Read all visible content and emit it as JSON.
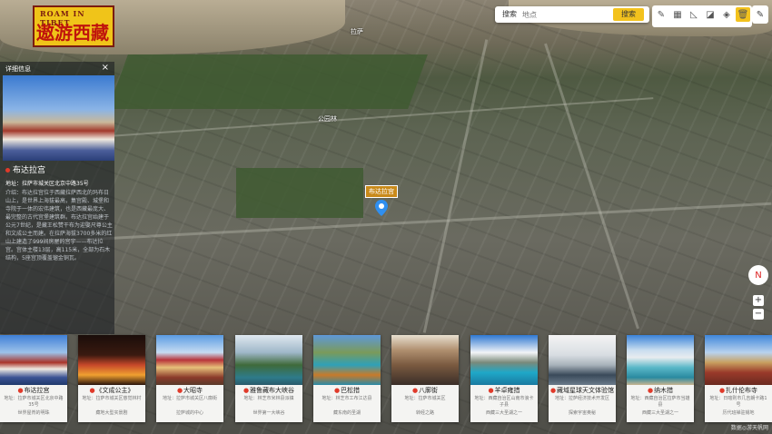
{
  "app": {
    "logo_en": "ROAM IN TIBET",
    "logo_cn": "遨游西藏"
  },
  "search": {
    "label": "搜索",
    "placeholder": "地点",
    "button": "搜索"
  },
  "toolbar": {
    "tools": [
      {
        "icon": "ruler-icon",
        "glyph": "✎"
      },
      {
        "icon": "area-icon",
        "glyph": "▦"
      },
      {
        "icon": "angle-icon",
        "glyph": "◺"
      },
      {
        "icon": "layers-icon",
        "glyph": "◪"
      },
      {
        "icon": "marker-tool-icon",
        "glyph": "◈"
      },
      {
        "icon": "trash-icon",
        "glyph": "🗑"
      }
    ],
    "edit_glyph": "✎"
  },
  "map": {
    "labels": [
      "公园林",
      "拉萨"
    ],
    "marker_label": "布达拉宫"
  },
  "detail": {
    "header": "详细信息",
    "close": "×",
    "title": "布达拉宫",
    "address": "地址：拉萨市城关区北京中路35号",
    "description": "介绍：布达拉宫位于西藏拉萨西北的玛布日山上，是世界上海拔最高，集宫殿、城堡和寺院于一体的宏伟建筑，也是西藏最庞大、最完整的古代宫堡建筑群。布达拉宫始建于公元7世纪，是藏王松赞干布为迎娶尺尊公主和文成公主而建。在拉萨海拔3700多米的红山上建造了999间房屋的宫宇——布达拉宫。宫体主楼13层，高115米，全部为石木结构，5座宫顶覆盖镏金铜瓦。"
  },
  "controls": {
    "compass": "N",
    "zoom_in": "+",
    "zoom_out": "−"
  },
  "cards": [
    {
      "name": "布达拉宫",
      "addr": "地址：拉萨市城关区北京中路35号",
      "desc": "世界屋脊的明珠"
    },
    {
      "name": "《文成公主》",
      "addr": "地址：拉萨市城关区慈觉林村",
      "desc": "藏地大型实景剧"
    },
    {
      "name": "大昭寺",
      "addr": "地址：拉萨市城关区八廓街",
      "desc": "拉萨城的中心"
    },
    {
      "name": "雅鲁藏布大峡谷",
      "addr": "地址：林芝市米林县派镇",
      "desc": "世界第一大峡谷"
    },
    {
      "name": "巴松措",
      "addr": "地址：林芝市工布江达县",
      "desc": "藏东南的圣湖"
    },
    {
      "name": "八廓街",
      "addr": "地址：拉萨市城关区",
      "desc": "转经之路"
    },
    {
      "name": "羊卓雍措",
      "addr": "地址：西藏自治区山南市浪卡子县",
      "desc": "西藏三大圣湖之一"
    },
    {
      "name": "藏域星球天文体验馆",
      "addr": "地址：拉萨经济技术开发区",
      "desc": "探索宇宙奥秘"
    },
    {
      "name": "纳木措",
      "addr": "地址：西藏自治区拉萨市当雄县",
      "desc": "西藏三大圣湖之一"
    },
    {
      "name": "扎什伦布寺",
      "addr": "地址：日喀则市几吉朗卡路1号",
      "desc": "历代班禅驻锡地"
    }
  ],
  "credit": "数据◎游天帆网"
}
